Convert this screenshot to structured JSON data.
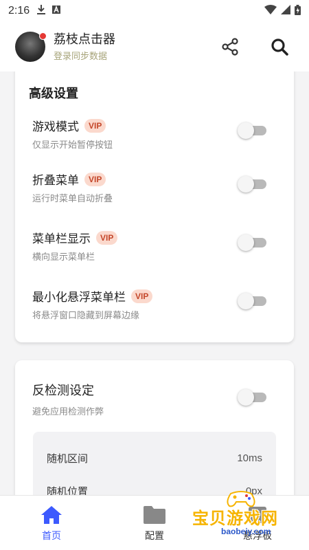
{
  "status_bar": {
    "time": "2:16"
  },
  "header": {
    "title": "荔枝点击器",
    "subtitle": "登录同步数据"
  },
  "advanced": {
    "title": "高级设置",
    "items": [
      {
        "label": "游戏模式",
        "badge": "VIP",
        "desc": "仅显示开始暂停按钮",
        "enabled": false
      },
      {
        "label": "折叠菜单",
        "badge": "VIP",
        "desc": "运行时菜单自动折叠",
        "enabled": false
      },
      {
        "label": "菜单栏显示",
        "badge": "VIP",
        "desc": "横向显示菜单栏",
        "enabled": false
      },
      {
        "label": "最小化悬浮菜单栏",
        "badge": "VIP",
        "desc": "将悬浮窗口隐藏到屏幕边缘",
        "enabled": false
      }
    ]
  },
  "anti_detect": {
    "title": "反检测设定",
    "desc": "避免应用检测作弊",
    "enabled": false,
    "rows": [
      {
        "label": "随机区间",
        "value": "10ms"
      },
      {
        "label": "随机位置",
        "value": "0px"
      }
    ]
  },
  "bottom_nav": [
    {
      "label": "首页",
      "active": true
    },
    {
      "label": "配置",
      "active": false
    },
    {
      "label": "悬浮板",
      "active": false
    }
  ],
  "watermark": {
    "text": "宝贝游戏网",
    "url": "baobeiy.com"
  },
  "colors": {
    "accent": "#3d5afe",
    "vip_bg": "#fbd9cd",
    "vip_text": "#c4472a"
  }
}
